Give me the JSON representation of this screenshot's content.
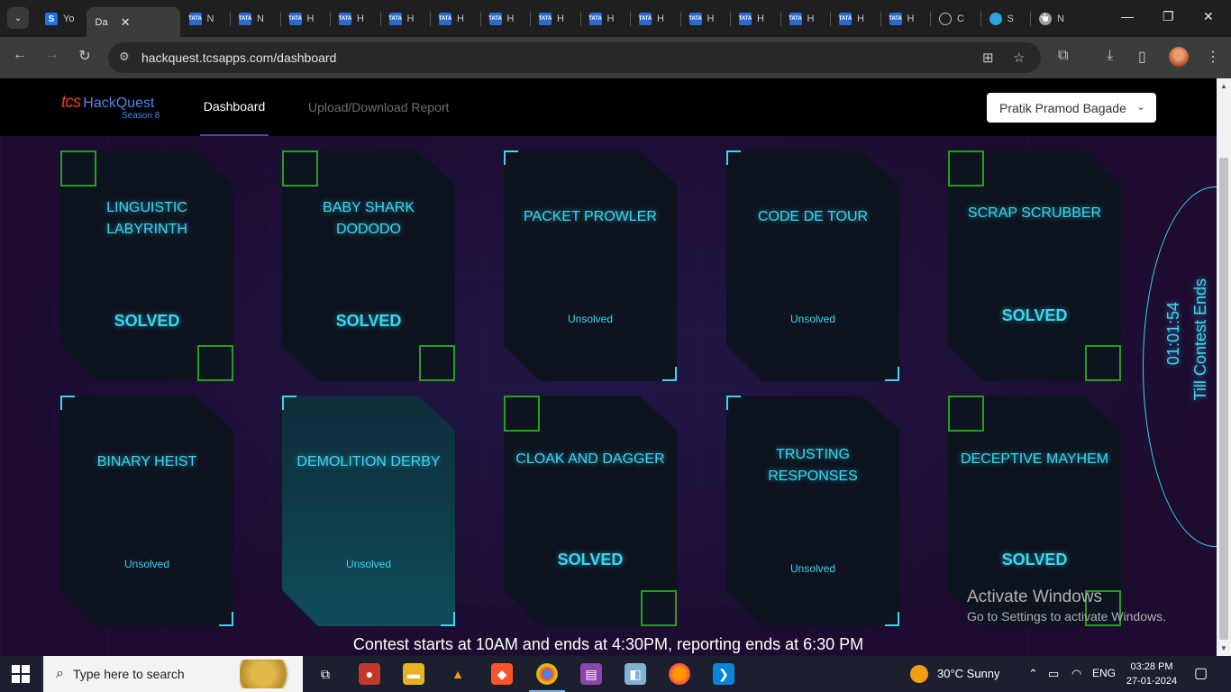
{
  "browser": {
    "tabs": [
      {
        "label": "Yo",
        "favicon": "S"
      },
      {
        "label": "Da",
        "favicon": "D",
        "active": true
      },
      {
        "label": "N",
        "favicon": "TATA"
      },
      {
        "label": "N",
        "favicon": "TATA"
      },
      {
        "label": "H",
        "favicon": "TATA"
      },
      {
        "label": "H",
        "favicon": "TATA"
      },
      {
        "label": "H",
        "favicon": "TATA"
      },
      {
        "label": "H",
        "favicon": "TATA"
      },
      {
        "label": "H",
        "favicon": "TATA"
      },
      {
        "label": "H",
        "favicon": "TATA"
      },
      {
        "label": "H",
        "favicon": "TATA"
      },
      {
        "label": "H",
        "favicon": "TATA"
      },
      {
        "label": "H",
        "favicon": "TATA"
      },
      {
        "label": "H",
        "favicon": "TATA"
      },
      {
        "label": "H",
        "favicon": "TATA"
      },
      {
        "label": "H",
        "favicon": "TATA"
      },
      {
        "label": "H",
        "favicon": "TATA"
      },
      {
        "label": "C",
        "favicon": "openai"
      },
      {
        "label": "S",
        "favicon": "telegram"
      },
      {
        "label": "N",
        "favicon": "chrome"
      }
    ],
    "url": "hackquest.tcsapps.com/dashboard",
    "active_tab_close": "✕",
    "new_tab": "+"
  },
  "header": {
    "logo_tcs": "tcs",
    "logo_name": "HackQuest",
    "logo_season": "Season 8",
    "nav_dashboard": "Dashboard",
    "nav_upload": "Upload/Download Report",
    "user_name": "Pratik Pramod Bagade"
  },
  "challenges": [
    {
      "title": "LINGUISTIC\nLABYRINTH",
      "status": "SOLVED"
    },
    {
      "title": "BABY SHARK\nDODODO",
      "status": "SOLVED"
    },
    {
      "title": "PACKET PROWLER",
      "status": "Unsolved"
    },
    {
      "title": "CODE DE TOUR",
      "status": "Unsolved"
    },
    {
      "title": "SCRAP SCRUBBER",
      "status": "SOLVED"
    },
    {
      "title": "BINARY HEIST",
      "status": "Unsolved"
    },
    {
      "title": "DEMOLITION DERBY",
      "status": "Unsolved"
    },
    {
      "title": "CLOAK AND DAGGER",
      "status": "SOLVED"
    },
    {
      "title": "TRUSTING\nRESPONSES",
      "status": "Unsolved"
    },
    {
      "title": "DECEPTIVE MAYHEM",
      "status": "SOLVED"
    }
  ],
  "timer": {
    "time": "01:01:54",
    "label": "Till Contest Ends"
  },
  "contest_info": "Contest starts at 10AM and ends at 4:30PM, reporting ends at 6:30 PM",
  "watermark": {
    "line1": "Activate Windows",
    "line2": "Go to Settings to activate Windows."
  },
  "taskbar": {
    "search_placeholder": "Type here to search",
    "weather": "30°C  Sunny",
    "lang": "ENG",
    "time": "03:28 PM",
    "date": "27-01-2024"
  },
  "colors": {
    "accent": "#3ad6f0",
    "solved_marker": "#1fa01f",
    "brand_red": "#e03a2f",
    "brand_blue": "#4f86e8"
  }
}
